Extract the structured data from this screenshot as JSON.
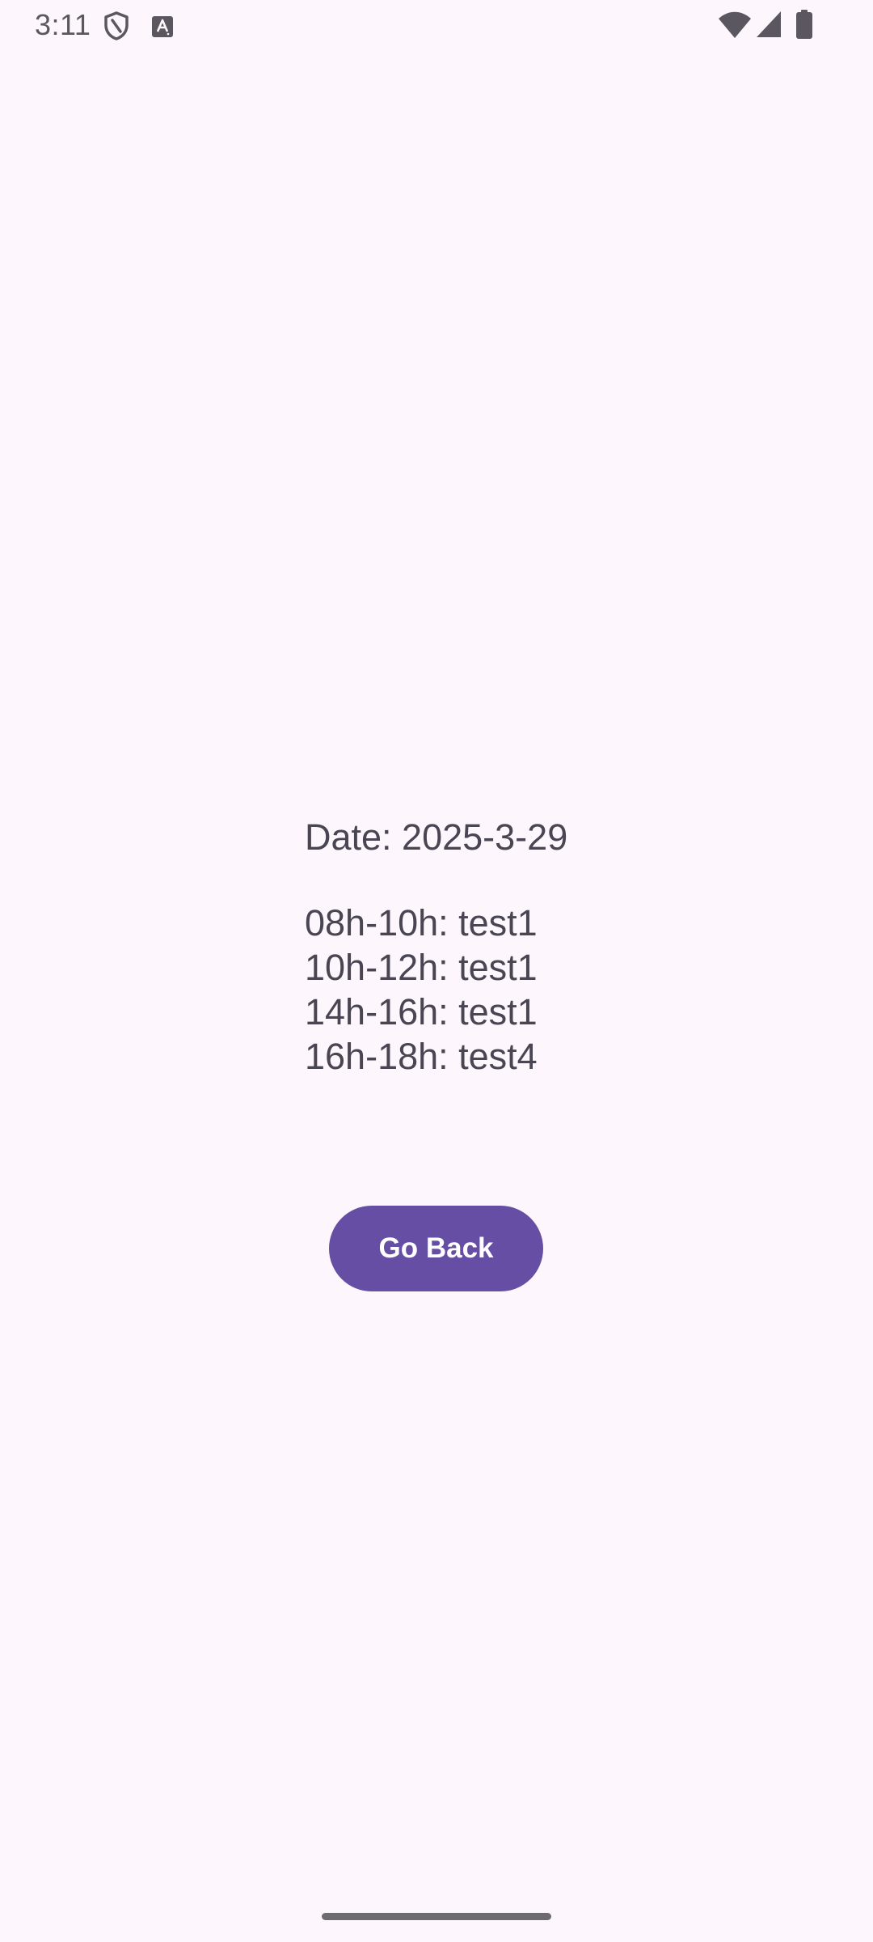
{
  "status_bar": {
    "time": "3:11",
    "icons": [
      "shield-icon",
      "text-input-icon",
      "wifi-icon",
      "cellular-signal-icon",
      "battery-icon"
    ]
  },
  "schedule": {
    "date_line": "Date: 2025-3-29",
    "entries": [
      "08h-10h: test1",
      "10h-12h: test1",
      "14h-16h: test1",
      "16h-18h: test4"
    ]
  },
  "actions": {
    "go_back_label": "Go Back"
  },
  "colors": {
    "background": "#fdf7fd",
    "text": "#4a4553",
    "button": "#654ea3",
    "button_text": "#ffffff"
  }
}
